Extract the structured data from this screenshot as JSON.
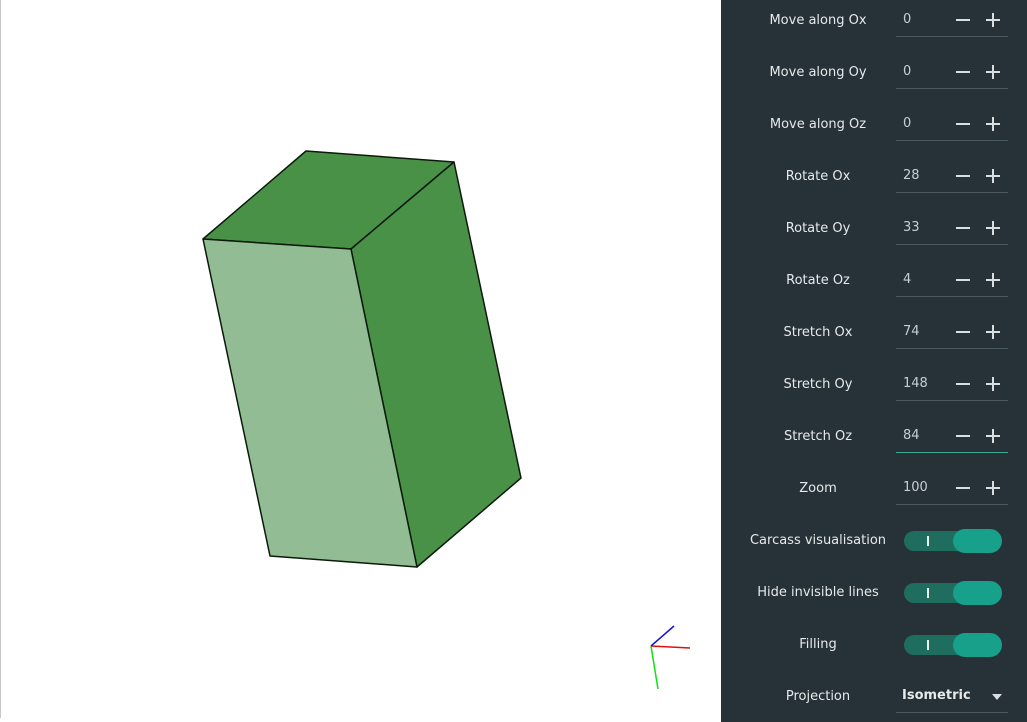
{
  "controls": {
    "move_ox": {
      "label": "Move along Ox",
      "value": "0"
    },
    "move_oy": {
      "label": "Move along Oy",
      "value": "0"
    },
    "move_oz": {
      "label": "Move along Oz",
      "value": "0"
    },
    "rotate_ox": {
      "label": "Rotate Ox",
      "value": "28"
    },
    "rotate_oy": {
      "label": "Rotate Oy",
      "value": "33"
    },
    "rotate_oz": {
      "label": "Rotate Oz",
      "value": "4"
    },
    "stretch_ox": {
      "label": "Stretch Ox",
      "value": "74"
    },
    "stretch_oy": {
      "label": "Stretch Oy",
      "value": "148"
    },
    "stretch_oz": {
      "label": "Stretch Oz",
      "value": "84"
    },
    "zoom": {
      "label": "Zoom",
      "value": "100"
    },
    "carcass": {
      "label": "Carcass visualisation",
      "on": true
    },
    "hide_lines": {
      "label": "Hide invisible lines",
      "on": true
    },
    "filling": {
      "label": "Filling",
      "on": true
    },
    "projection": {
      "label": "Projection",
      "value": "Isometric"
    }
  },
  "toggle_glyph": "I",
  "colors": {
    "panel_bg": "#263238",
    "accent": "#17a08a",
    "face_dark": "#4a9148",
    "face_light": "#92bc93",
    "axis_x": "#e01010",
    "axis_y": "#10e010",
    "axis_z": "#1010e0"
  },
  "icons": {
    "decrement": "minus-icon",
    "increment": "plus-icon",
    "dropdown": "triangle-down-icon"
  }
}
